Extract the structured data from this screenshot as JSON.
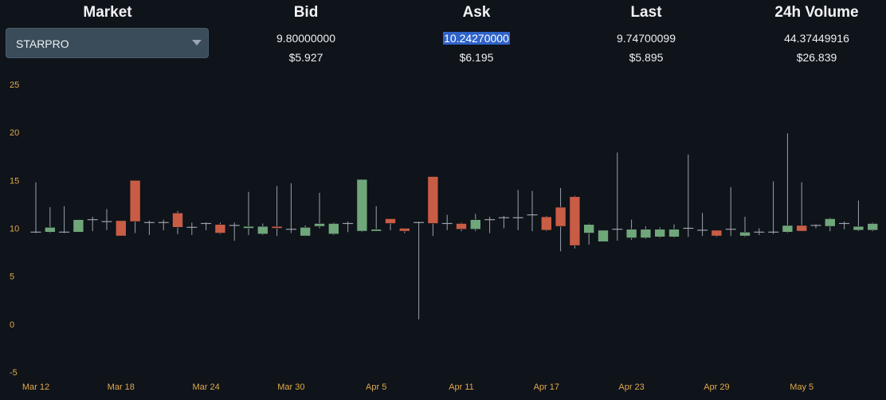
{
  "header": {
    "market_title": "Market",
    "bid_title": "Bid",
    "ask_title": "Ask",
    "last_title": "Last",
    "volume_title": "24h Volume",
    "market_selected": "STARPRO",
    "bid_value": "9.80000000",
    "bid_usd": "$5.927",
    "ask_value": "10.24270000",
    "ask_usd": "$6.195",
    "last_value": "9.74700099",
    "last_usd": "$5.895",
    "volume_value": "44.37449916",
    "volume_usd": "$26.839"
  },
  "colors": {
    "up": "#6fa67a",
    "down": "#c95c45",
    "wick": "#9aa3ad",
    "tick_label": "#e0a94a",
    "highlight": "#2f63c9"
  },
  "icons": {
    "dropdown": "chevron-down-icon"
  },
  "chart_data": {
    "type": "candlestick",
    "ylim": [
      -5,
      25
    ],
    "yticks": [
      25,
      20,
      15,
      10,
      5,
      0,
      -5
    ],
    "xticks": [
      "Mar 12",
      "Mar 18",
      "Mar 24",
      "Mar 30",
      "Apr 5",
      "Apr 11",
      "Apr 17",
      "Apr 23",
      "Apr 29",
      "May 5"
    ],
    "grid": false,
    "candles": [
      {
        "date": "Mar 12",
        "open": 9.6,
        "close": 9.6,
        "high": 14.8,
        "low": 9.5
      },
      {
        "date": "Mar 13",
        "open": 9.6,
        "close": 10.1,
        "high": 12.2,
        "low": 9.5
      },
      {
        "date": "Mar 14",
        "open": 9.6,
        "close": 9.6,
        "high": 12.3,
        "low": 9.5
      },
      {
        "date": "Mar 15",
        "open": 9.6,
        "close": 10.9,
        "high": 10.9,
        "low": 9.6
      },
      {
        "date": "Mar 16",
        "open": 10.9,
        "close": 10.8,
        "high": 11.2,
        "low": 9.7
      },
      {
        "date": "Mar 17",
        "open": 10.7,
        "close": 10.7,
        "high": 12.0,
        "low": 9.8
      },
      {
        "date": "Mar 18",
        "open": 10.8,
        "close": 9.2,
        "high": 10.8,
        "low": 9.2
      },
      {
        "date": "Mar 19",
        "open": 15.0,
        "close": 10.7,
        "high": 15.0,
        "low": 9.5
      },
      {
        "date": "Mar 20",
        "open": 10.6,
        "close": 10.6,
        "high": 10.8,
        "low": 9.3
      },
      {
        "date": "Mar 21",
        "open": 10.6,
        "close": 10.6,
        "high": 10.9,
        "low": 9.8
      },
      {
        "date": "Mar 22",
        "open": 11.6,
        "close": 10.1,
        "high": 11.8,
        "low": 9.4
      },
      {
        "date": "Mar 23",
        "open": 10.1,
        "close": 10.1,
        "high": 10.6,
        "low": 9.3
      },
      {
        "date": "Mar 24",
        "open": 10.5,
        "close": 10.4,
        "high": 10.6,
        "low": 9.8
      },
      {
        "date": "Mar 25",
        "open": 10.4,
        "close": 9.5,
        "high": 10.6,
        "low": 9.4
      },
      {
        "date": "Mar 26",
        "open": 10.3,
        "close": 10.3,
        "high": 10.6,
        "low": 8.7
      },
      {
        "date": "Mar 27",
        "open": 10.0,
        "close": 10.2,
        "high": 13.8,
        "low": 9.3
      },
      {
        "date": "Mar 28",
        "open": 9.4,
        "close": 10.2,
        "high": 10.5,
        "low": 9.3
      },
      {
        "date": "Mar 29",
        "open": 10.2,
        "close": 10.0,
        "high": 14.4,
        "low": 9.2
      },
      {
        "date": "Mar 30",
        "open": 9.9,
        "close": 9.9,
        "high": 14.7,
        "low": 9.5
      },
      {
        "date": "Mar 31",
        "open": 9.2,
        "close": 10.1,
        "high": 10.3,
        "low": 9.2
      },
      {
        "date": "Apr 1",
        "open": 10.2,
        "close": 10.5,
        "high": 13.7,
        "low": 10.0
      },
      {
        "date": "Apr 2",
        "open": 9.4,
        "close": 10.5,
        "high": 10.6,
        "low": 9.3
      },
      {
        "date": "Apr 3",
        "open": 10.5,
        "close": 10.5,
        "high": 10.7,
        "low": 9.6
      },
      {
        "date": "Apr 4",
        "open": 9.7,
        "close": 15.1,
        "high": 15.1,
        "low": 9.6
      },
      {
        "date": "Apr 5",
        "open": 9.7,
        "close": 9.9,
        "high": 12.3,
        "low": 9.7
      },
      {
        "date": "Apr 6",
        "open": 11.0,
        "close": 10.5,
        "high": 11.0,
        "low": 9.8
      },
      {
        "date": "Apr 7",
        "open": 10.0,
        "close": 9.7,
        "high": 10.0,
        "low": 9.5
      },
      {
        "date": "Apr 8",
        "open": 10.6,
        "close": 10.6,
        "high": 10.7,
        "low": 0.5
      },
      {
        "date": "Apr 9",
        "open": 15.4,
        "close": 10.5,
        "high": 15.4,
        "low": 9.2
      },
      {
        "date": "Apr 10",
        "open": 10.5,
        "close": 10.5,
        "high": 11.4,
        "low": 9.8
      },
      {
        "date": "Apr 11",
        "open": 10.5,
        "close": 9.9,
        "high": 10.6,
        "low": 9.7
      },
      {
        "date": "Apr 12",
        "open": 9.9,
        "close": 10.9,
        "high": 11.5,
        "low": 9.7
      },
      {
        "date": "Apr 13",
        "open": 10.9,
        "close": 10.9,
        "high": 11.2,
        "low": 9.5
      },
      {
        "date": "Apr 14",
        "open": 11.1,
        "close": 11.1,
        "high": 11.3,
        "low": 10.0
      },
      {
        "date": "Apr 15",
        "open": 11.1,
        "close": 11.1,
        "high": 14.0,
        "low": 9.8
      },
      {
        "date": "Apr 16",
        "open": 11.4,
        "close": 11.4,
        "high": 13.9,
        "low": 9.7
      },
      {
        "date": "Apr 17",
        "open": 11.2,
        "close": 9.8,
        "high": 11.3,
        "low": 9.7
      },
      {
        "date": "Apr 18",
        "open": 12.2,
        "close": 10.2,
        "high": 14.2,
        "low": 7.6
      },
      {
        "date": "Apr 19",
        "open": 13.3,
        "close": 8.2,
        "high": 13.4,
        "low": 7.9
      },
      {
        "date": "Apr 20",
        "open": 9.5,
        "close": 10.4,
        "high": 10.5,
        "low": 8.3
      },
      {
        "date": "Apr 21",
        "open": 8.6,
        "close": 9.8,
        "high": 9.8,
        "low": 8.6
      },
      {
        "date": "Apr 22",
        "open": 9.9,
        "close": 9.9,
        "high": 17.9,
        "low": 8.7
      },
      {
        "date": "Apr 23",
        "open": 9.0,
        "close": 9.9,
        "high": 10.9,
        "low": 8.8
      },
      {
        "date": "Apr 24",
        "open": 9.0,
        "close": 9.9,
        "high": 10.2,
        "low": 8.9
      },
      {
        "date": "Apr 25",
        "open": 9.1,
        "close": 9.9,
        "high": 10.1,
        "low": 9.0
      },
      {
        "date": "Apr 26",
        "open": 9.1,
        "close": 9.9,
        "high": 10.4,
        "low": 9.0
      },
      {
        "date": "Apr 27",
        "open": 10.0,
        "close": 10.0,
        "high": 17.7,
        "low": 9.1
      },
      {
        "date": "Apr 28",
        "open": 9.8,
        "close": 9.7,
        "high": 11.6,
        "low": 9.2
      },
      {
        "date": "Apr 29",
        "open": 9.8,
        "close": 9.2,
        "high": 9.8,
        "low": 9.1
      },
      {
        "date": "Apr 30",
        "open": 9.9,
        "close": 9.9,
        "high": 14.3,
        "low": 9.2
      },
      {
        "date": "May 1",
        "open": 9.2,
        "close": 9.6,
        "high": 11.2,
        "low": 9.1
      },
      {
        "date": "May 2",
        "open": 9.6,
        "close": 9.6,
        "high": 10.0,
        "low": 9.3
      },
      {
        "date": "May 3",
        "open": 9.6,
        "close": 9.6,
        "high": 14.9,
        "low": 9.4
      },
      {
        "date": "May 4",
        "open": 9.6,
        "close": 10.3,
        "high": 19.9,
        "low": 9.5
      },
      {
        "date": "May 5",
        "open": 10.3,
        "close": 9.7,
        "high": 14.8,
        "low": 9.7
      },
      {
        "date": "May 6",
        "open": 10.3,
        "close": 10.3,
        "high": 10.4,
        "low": 10.0
      },
      {
        "date": "May 7",
        "open": 10.2,
        "close": 11.0,
        "high": 11.1,
        "low": 9.7
      },
      {
        "date": "May 8",
        "open": 10.5,
        "close": 10.5,
        "high": 10.7,
        "low": 9.9
      },
      {
        "date": "May 9",
        "open": 9.8,
        "close": 10.2,
        "high": 12.9,
        "low": 9.7
      },
      {
        "date": "May 10",
        "open": 9.8,
        "close": 10.5,
        "high": 10.6,
        "low": 9.7
      }
    ]
  }
}
